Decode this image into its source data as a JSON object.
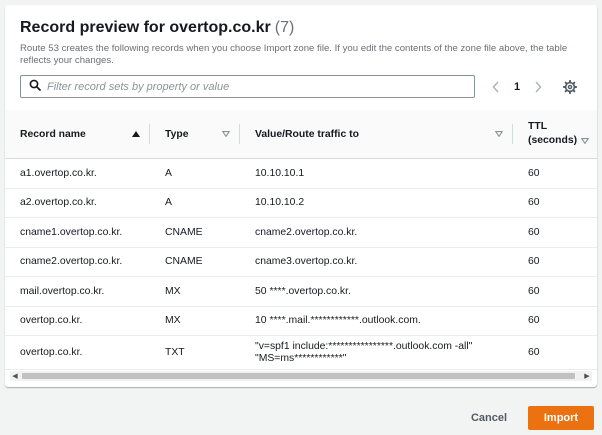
{
  "modal": {
    "title": "Record preview for overtop.co.kr",
    "count": "(7)",
    "description": "Route 53 creates the following records when you choose Import zone file. If you edit the contents of the zone file above, the table reflects your changes."
  },
  "search": {
    "placeholder": "Filter record sets by property or value",
    "value": ""
  },
  "pagination": {
    "current_page": "1"
  },
  "table": {
    "columns": [
      {
        "label": "Record name",
        "sort": "ascending"
      },
      {
        "label": "Type",
        "sort": "none"
      },
      {
        "label": "Value/Route traffic to",
        "sort": "none"
      },
      {
        "label": "TTL (seconds)",
        "sort": "none"
      }
    ],
    "rows": [
      {
        "name": "a1.overtop.co.kr.",
        "type": "A",
        "value": [
          "10.10.10.1"
        ],
        "ttl": "60"
      },
      {
        "name": "a2.overtop.co.kr.",
        "type": "A",
        "value": [
          "10.10.10.2"
        ],
        "ttl": "60"
      },
      {
        "name": "cname1.overtop.co.kr.",
        "type": "CNAME",
        "value": [
          "cname2.overtop.co.kr."
        ],
        "ttl": "60"
      },
      {
        "name": "cname2.overtop.co.kr.",
        "type": "CNAME",
        "value": [
          "cname3.overtop.co.kr."
        ],
        "ttl": "60"
      },
      {
        "name": "mail.overtop.co.kr.",
        "type": "MX",
        "value": [
          "50 ****.overtop.co.kr."
        ],
        "ttl": "60"
      },
      {
        "name": "overtop.co.kr.",
        "type": "MX",
        "value": [
          "10 ****.mail.************.outlook.com."
        ],
        "ttl": "60"
      },
      {
        "name": "overtop.co.kr.",
        "type": "TXT",
        "value": [
          "\"v=spf1 include:****************.outlook.com -all\"",
          "\"MS=ms************\""
        ],
        "ttl": "60"
      }
    ]
  },
  "footer": {
    "cancel_label": "Cancel",
    "import_label": "Import"
  },
  "colors": {
    "primary": "#ec7211",
    "border": "#d5dbdb",
    "muted": "#687078"
  },
  "icons": {
    "search": "search-icon",
    "prev": "chevron-left-icon",
    "next": "chevron-right-icon",
    "settings": "gear-icon",
    "sort_asc": "sort-ascending-icon",
    "sort_none": "sort-unsorted-icon"
  }
}
